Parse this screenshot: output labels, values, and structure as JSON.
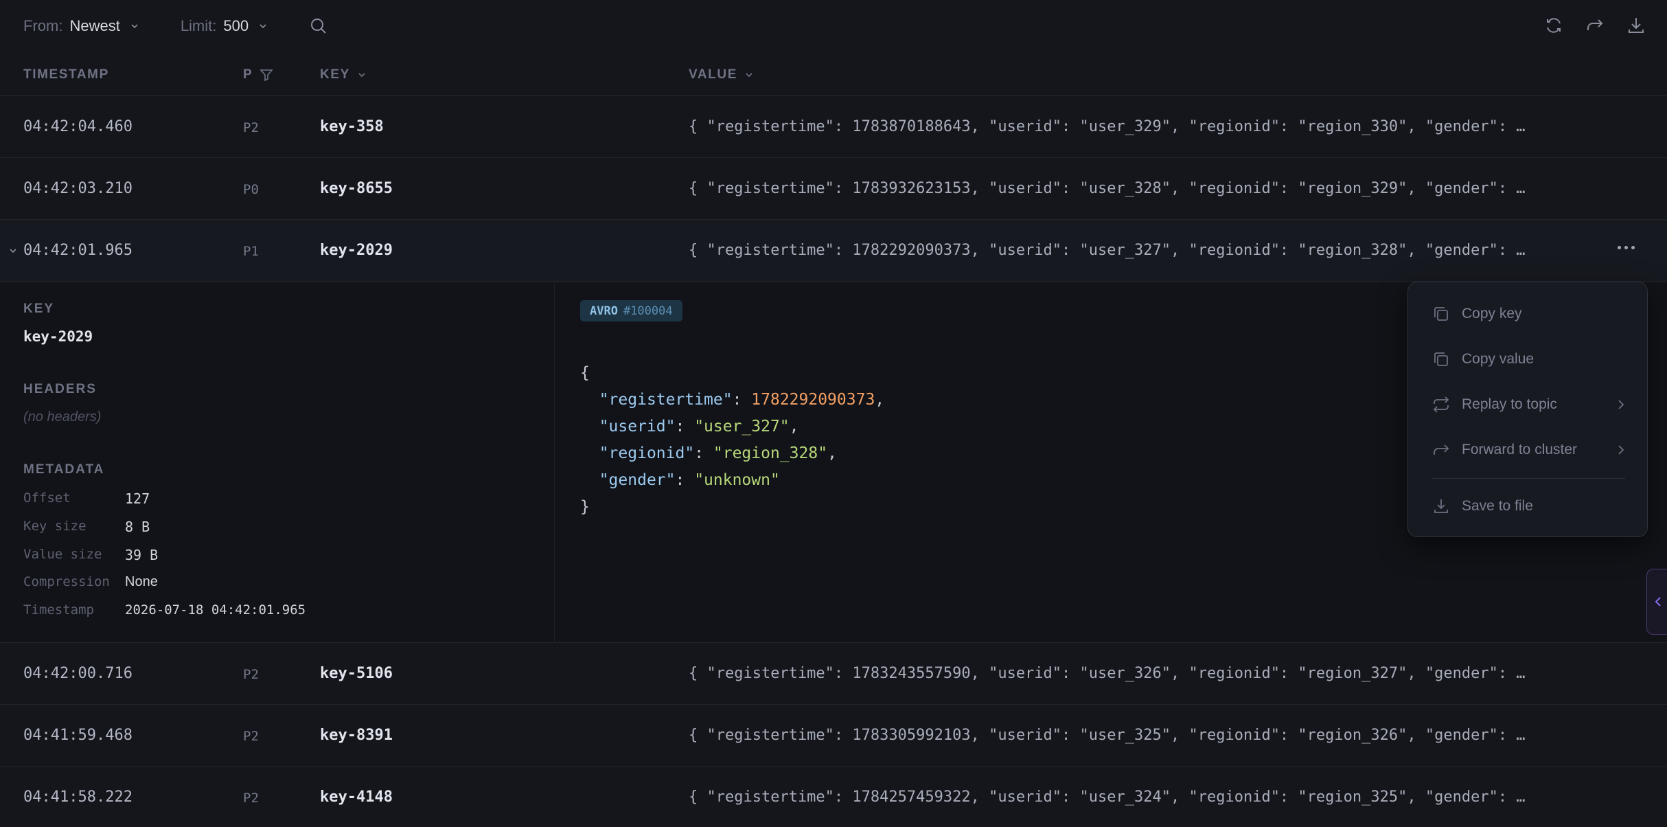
{
  "toolbar": {
    "from_label": "From:",
    "from_value": "Newest",
    "limit_label": "Limit:",
    "limit_value": "500"
  },
  "columns": {
    "timestamp": "TIMESTAMP",
    "partition": "P",
    "key": "KEY",
    "value": "VALUE"
  },
  "rows": [
    {
      "ts": "04:42:04.460",
      "p": "P2",
      "key": "key-358",
      "value": "{ \"registertime\": 1783870188643, \"userid\": \"user_329\", \"regionid\": \"region_330\", \"gender\": …"
    },
    {
      "ts": "04:42:03.210",
      "p": "P0",
      "key": "key-8655",
      "value": "{ \"registertime\": 1783932623153, \"userid\": \"user_328\", \"regionid\": \"region_329\", \"gender\": …"
    },
    {
      "ts": "04:42:01.965",
      "p": "P1",
      "key": "key-2029",
      "value": "{ \"registertime\": 1782292090373, \"userid\": \"user_327\", \"regionid\": \"region_328\", \"gender\": …"
    },
    {
      "ts": "04:42:00.716",
      "p": "P2",
      "key": "key-5106",
      "value": "{ \"registertime\": 1783243557590, \"userid\": \"user_326\", \"regionid\": \"region_327\", \"gender\": …"
    },
    {
      "ts": "04:41:59.468",
      "p": "P2",
      "key": "key-8391",
      "value": "{ \"registertime\": 1783305992103, \"userid\": \"user_325\", \"regionid\": \"region_326\", \"gender\": …"
    },
    {
      "ts": "04:41:58.222",
      "p": "P2",
      "key": "key-4148",
      "value": "{ \"registertime\": 1784257459322, \"userid\": \"user_324\", \"regionid\": \"region_325\", \"gender\": …"
    }
  ],
  "detail": {
    "key_title": "KEY",
    "key_value": "key-2029",
    "headers_title": "HEADERS",
    "no_headers": "(no headers)",
    "metadata_title": "METADATA",
    "metadata": [
      {
        "k": "Offset",
        "v": "127"
      },
      {
        "k": "Key size",
        "v": "8 B"
      },
      {
        "k": "Value size",
        "v": "39 B"
      },
      {
        "k": "Compression",
        "v": "None"
      },
      {
        "k": "Timestamp",
        "v": "2026-07-18 04:42:01.965"
      }
    ],
    "format": "AVRO",
    "schema_id": "#100004",
    "json": {
      "open": "{",
      "close": "}",
      "registertime_key": "\"registertime\"",
      "registertime_val": "1782292090373",
      "userid_key": "\"userid\"",
      "userid_val": "\"user_327\"",
      "regionid_key": "\"regionid\"",
      "regionid_val": "\"region_328\"",
      "gender_key": "\"gender\"",
      "gender_val": "\"unknown\""
    }
  },
  "menu": {
    "copy_key": "Copy key",
    "copy_value": "Copy value",
    "replay": "Replay to topic",
    "forward": "Forward to cluster",
    "save": "Save to file"
  }
}
